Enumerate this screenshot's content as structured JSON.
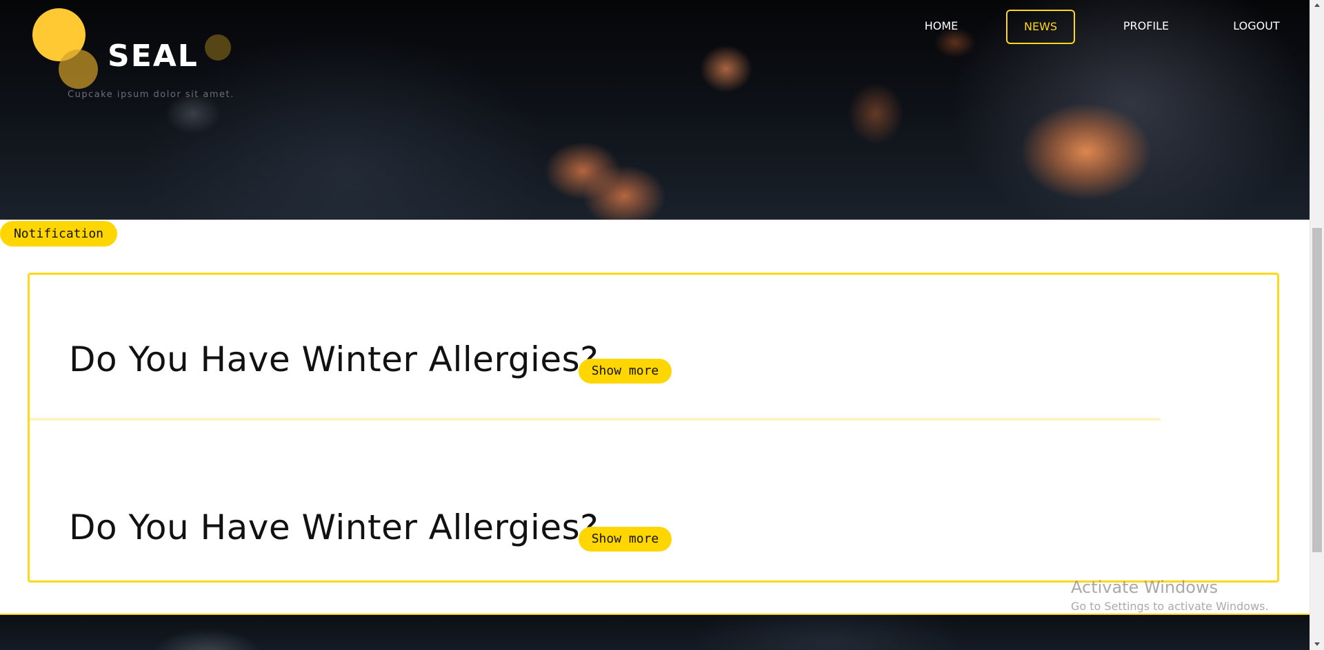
{
  "brand": {
    "name": "SEAL",
    "tagline": "Cupcake ipsum dolor sit amet.",
    "accent_color": "#ffd600"
  },
  "nav": {
    "items": [
      {
        "label": "HOME",
        "active": false
      },
      {
        "label": "NEWS",
        "active": true
      },
      {
        "label": "PROFILE",
        "active": false
      },
      {
        "label": "LOGOUT",
        "active": false
      }
    ]
  },
  "notification": {
    "label": "Notification"
  },
  "news": {
    "items": [
      {
        "title": "Do You Have Winter Allergies?",
        "button_label": "Show more"
      },
      {
        "title": "Do You Have Winter Allergies?",
        "button_label": "Show more"
      }
    ]
  },
  "watermark": {
    "title": "Activate Windows",
    "subtitle": "Go to Settings to activate Windows."
  }
}
